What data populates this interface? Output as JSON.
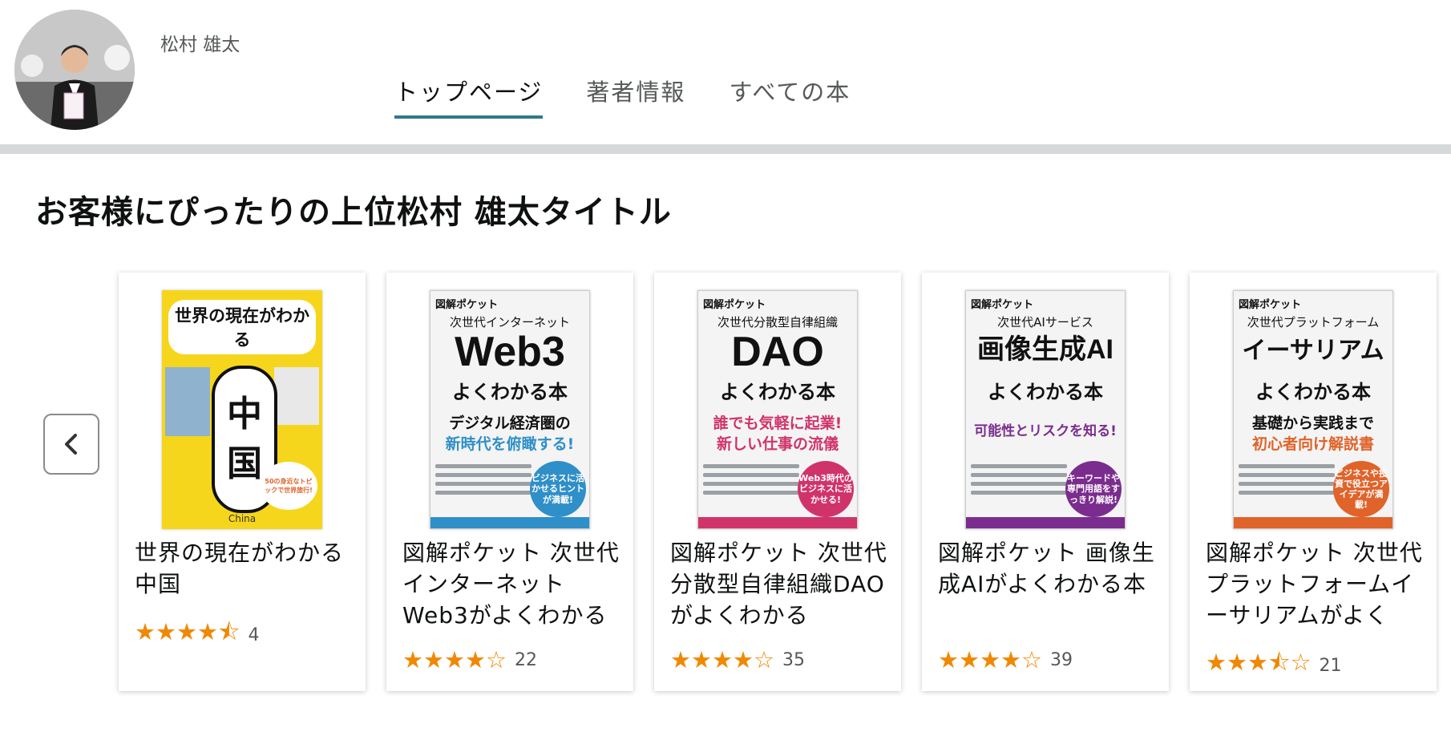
{
  "header": {
    "author_name": "松村 雄太",
    "tabs": [
      {
        "label": "トップページ",
        "active": true
      },
      {
        "label": "著者情報",
        "active": false
      },
      {
        "label": "すべての本",
        "active": false
      }
    ]
  },
  "section": {
    "title": "お客様にぴったりの上位松村 雄太タイトル",
    "prev_label": "‹"
  },
  "books": [
    {
      "title": "世界の現在がわかる　中国",
      "stars": "★★★★⯪",
      "rating": 4.5,
      "reviews": "4",
      "cover": {
        "title": "世界の現在がわかる",
        "big": "中国",
        "english": "China",
        "badge": "50の身近なトピックで世界旅行!"
      }
    },
    {
      "title": "図解ポケット 次世代インターネットWeb3がよくわかる",
      "stars": "★★★★☆",
      "rating": 4.0,
      "reviews": "22",
      "cover": {
        "badge": "図解ポケット",
        "sub": "次世代インターネット",
        "big": "Web3",
        "book": "よくわかる本",
        "tag1": "デジタル経済圏の",
        "tag2": "新時代を俯瞰する!",
        "circle": "ビジネスに活かせるヒントが満載!",
        "accent": "#2f8fc8"
      }
    },
    {
      "title": "図解ポケット 次世代分散型自律組織DAOがよくわかる",
      "stars": "★★★★☆",
      "rating": 4.0,
      "reviews": "35",
      "cover": {
        "badge": "図解ポケット",
        "sub": "次世代分散型自律組織",
        "big": "DAO",
        "book": "よくわかる本",
        "tag1": "誰でも気軽に起業!",
        "tag2": "新しい仕事の流儀",
        "circle": "Web3時代のビジネスに活かせる!",
        "accent": "#d0336a"
      }
    },
    {
      "title": "図解ポケット 画像生成AIがよくわかる本",
      "stars": "★★★★☆",
      "rating": 4.0,
      "reviews": "39",
      "cover": {
        "badge": "図解ポケット",
        "sub": "次世代AIサービス",
        "big": "画像生成AI",
        "book": "よくわかる本",
        "tag1": "可能性とリスクを知る!",
        "tag2": "",
        "circle": "キーワードや専門用語をすっきり解説!",
        "accent": "#7a2d8e"
      }
    },
    {
      "title": "図解ポケット 次世代プラットフォームイーサリアムがよく",
      "stars": "★★★⯪☆",
      "rating": 3.5,
      "reviews": "21",
      "cover": {
        "badge": "図解ポケット",
        "sub": "次世代プラットフォーム",
        "big": "イーサリアム",
        "book": "よくわかる本",
        "tag1": "基礎から実践まで",
        "tag2": "初心者向け解説書",
        "circle": "ビジネスや投資で役立つアイデアが満載!",
        "accent": "#e0632a"
      }
    }
  ],
  "colors": {
    "tab_underline": "#2e7a8c",
    "star": "#f08804",
    "divider": "#d5d9d9"
  }
}
